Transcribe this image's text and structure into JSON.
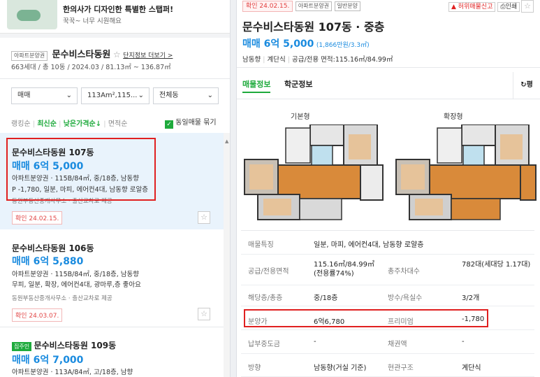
{
  "banner": {
    "title": "한의사가 디자인한 특별한 스탭퍼!",
    "subtitle": "꾹꾹~ 너무 시원해요"
  },
  "complex": {
    "badge": "아파트분양권",
    "name": "문수비스타동원",
    "star": "☆",
    "more": "단지정보 더보기 >",
    "info": "663세대 / 총 10동 / 2024.03 / 81.13㎡ ~ 136.87㎡"
  },
  "filters": {
    "trade": "매매",
    "area": "113Am²,115...",
    "dong": "전체동"
  },
  "sort": {
    "items": [
      "랭킹순",
      "최신순",
      "낮은가격순↓",
      "면적순"
    ],
    "same_listing": "동일매물 묶기"
  },
  "listings": [
    {
      "title": "문수비스타동원 107동",
      "price": "매매 6억 5,000",
      "meta": "아파트분양권 · 115B/84㎡, 중/18층, 남동향",
      "desc": "P -1,780, 일분, 마피, 에어컨4대, 남동향 로알층",
      "agent": "동원부동산중개사무소 · 출산교차로 제공",
      "confirm": "확인 24.02.15."
    },
    {
      "title": "문수비스타동원 106동",
      "price": "매매 6억 5,880",
      "meta": "아파트분양권 · 115B/84㎡, 중/18층, 남동향",
      "desc": "무피, 일분, 확장, 에어컨4대, 광마루,층 좋아요",
      "agent": "동원부동산중개사무소 · 출산교차로 제공",
      "confirm": "확인 24.03.07."
    },
    {
      "badge": "집주인",
      "title": "문수비스타동원 109동",
      "price": "매매 6억 7,000",
      "meta": "아파트분양권 · 113A/84㎡, 고/18층, 남향"
    }
  ],
  "detail": {
    "tags": [
      "확인 24.02.15.",
      "아파트분양권",
      "일반분양"
    ],
    "report": "허위매물신고",
    "print": "인쇄",
    "title": "문수비스타동원 107동 · 중층",
    "price": "매매 6억 5,000",
    "price_unit": "(1,866만원/3.3㎡)",
    "summary": [
      "남동향",
      "계단식",
      "공급/전용 면적:115.16㎡/84.99㎡"
    ],
    "tabs": [
      "매물정보",
      "학군정보"
    ],
    "tab_right": "평",
    "plan_labels": [
      "기본형",
      "확장형"
    ],
    "rows": [
      {
        "k1": "매물특징",
        "v1": "일분, 마피, 에어컨4대, 남동향 로얄층"
      },
      {
        "k1": "공급/전용면적",
        "v1": "115.16㎡/84.99㎡(전용률74%)",
        "k2": "총주차대수",
        "v2": "782대(세대당 1.17대)"
      },
      {
        "k1": "해당층/총층",
        "v1": "중/18층",
        "k2": "방수/욕실수",
        "v2": "3/2개"
      },
      {
        "k1": "분양가",
        "v1": "6억6,780",
        "k2": "프리미엄",
        "v2": "-1,780"
      },
      {
        "k1": "납부중도금",
        "v1": "-",
        "k2": "채권액",
        "v2": "-"
      },
      {
        "k1": "방향",
        "v1": "남동향(거실 기준)",
        "k2": "현관구조",
        "v2": "계단식"
      }
    ]
  }
}
